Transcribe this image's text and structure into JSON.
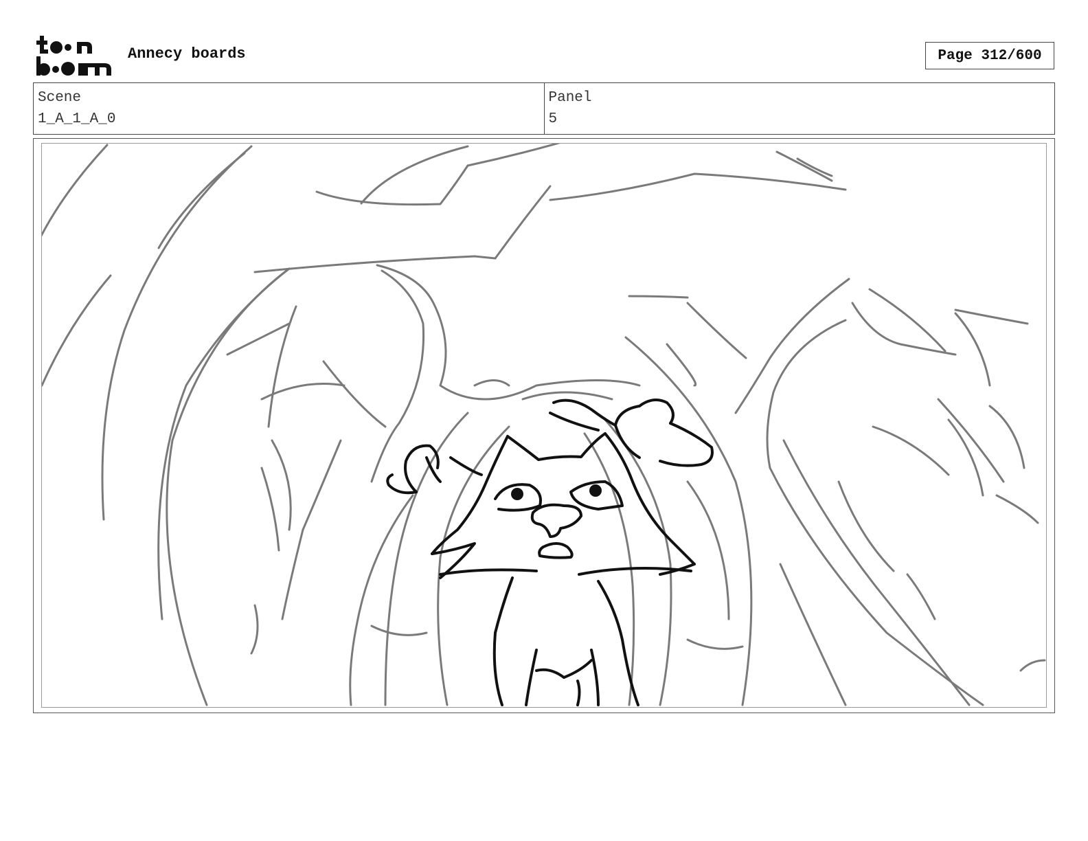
{
  "header": {
    "logo_top": "toon",
    "logo_bottom": "boom",
    "title": "Annecy boards",
    "page_label": "Page 312/600"
  },
  "info": {
    "scene_label": "Scene",
    "scene_value": "1_A_1_A_0",
    "panel_label": "Panel",
    "panel_value": "5"
  },
  "panel": {
    "image": "storyboard-sketch-fox-in-forest",
    "colors": {
      "rough": "#7a7a7a",
      "ink": "#111111"
    }
  }
}
